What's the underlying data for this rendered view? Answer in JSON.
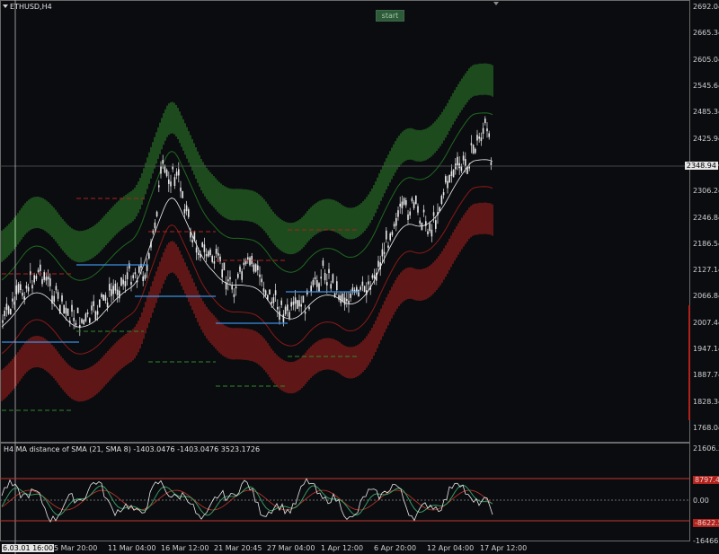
{
  "header": {
    "symbol_timeframe": "ETHUSD,H4",
    "start_button": "start"
  },
  "price_axis": {
    "labels": [
      "2692.04",
      "2665.34",
      "2605.04",
      "2545.64",
      "2485.34",
      "2425.94",
      "2365.64",
      "2306.24",
      "2246.84",
      "2186.54",
      "2127.14",
      "2066.84",
      "2007.44",
      "1947.14",
      "1887.74",
      "1828.34",
      "1768.04"
    ],
    "current_price": "2348.94",
    "top_price": "2692.04",
    "colors": {
      "current_tag_bg": "#e6e6e6"
    }
  },
  "indicator": {
    "title": "H4 MA distance of SMA (21, SMA 8) -1403.0476 -1403.0476 3523.1726",
    "axis_labels": [
      "21606.34",
      "8797.45",
      "0.00",
      "-8622.53",
      "-16466.43"
    ],
    "level_colors": {
      "upper": "#c0392b",
      "lower": "#c0392b",
      "zero": "#8a8a8a"
    }
  },
  "time_axis": {
    "labels": [
      "6.03.01 16:00",
      "5 Mar 20:00",
      "11 Mar 04:00",
      "16 Mar 12:00",
      "21 Mar 20:45",
      "27 Mar 04:00",
      "1 Apr 12:00",
      "6 Apr 20:00",
      "12 Apr 04:00",
      "17 Apr 12:00"
    ]
  },
  "colors": {
    "background": "#0b0c10",
    "upper_band": "#2f8a2a",
    "lower_band": "#b0221c",
    "candles": "#e8e8e8",
    "blue_lines": "#3a8fe0",
    "sma_line": "#f0f0f0"
  }
}
